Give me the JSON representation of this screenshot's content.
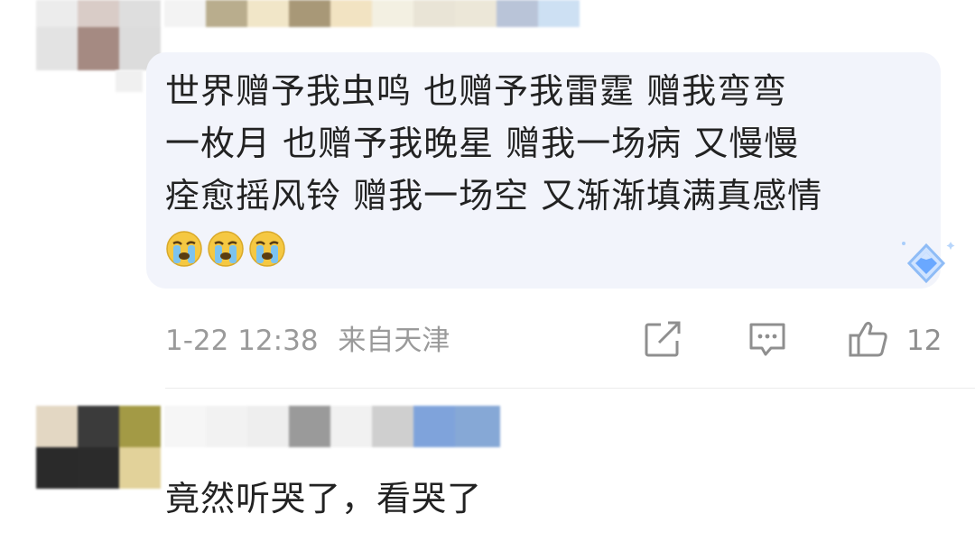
{
  "comments": [
    {
      "avatar_tiles": [
        [
          "#ececec",
          "#d9ccc7",
          "#dedede"
        ],
        [
          "#e3e3e3",
          "#a58a82",
          "#dcdcdc"
        ]
      ],
      "username_tiles": [
        "#e8e8e8",
        "#eeeeee",
        "#b9ad8d",
        "#f1e6c8",
        "#a89877",
        "#f2e3c2",
        "#f3f0e2",
        "#e9e4d6",
        "#ece7d8",
        "#b9c4d8",
        "#cde0f3"
      ],
      "text_lines": [
        "世界赠予我虫鸣 也赠予我雷霆 赠我弯弯",
        "一枚月 也赠予我晚星 赠我一场病 又慢慢",
        "痊愈摇风铃 赠我一场空 又渐渐填满真感情"
      ],
      "emojis": [
        "crying-face",
        "crying-face",
        "crying-face"
      ],
      "meta": {
        "time": "1-22 12:38",
        "location": "来自天津"
      },
      "actions": {
        "share_icon": "share-icon",
        "comment_icon": "comment-icon",
        "like_icon": "thumbs-up-icon",
        "like_count": "12"
      }
    },
    {
      "avatar_tiles": [
        [
          "#e3d7c3",
          "#3b3b3b",
          "#a39a45"
        ],
        [
          "#2a2a2a",
          "#2b2b2b",
          "#e2d29a"
        ]
      ],
      "username_tiles": [
        "#f2f2f2",
        "#f6f6f6",
        "#eeeeee",
        "#9a9a9a",
        "#f1f1f1",
        "#cfcfcf",
        "#7fa3db",
        "#86a8d6"
      ],
      "text": "竟然听哭了，看哭了"
    }
  ],
  "colors": {
    "bubble_bg": "#f2f4fb",
    "meta_gray": "#9a9a9a",
    "emoji_yellow": "#f5c842",
    "badge_blue": "#6aa8ff"
  }
}
